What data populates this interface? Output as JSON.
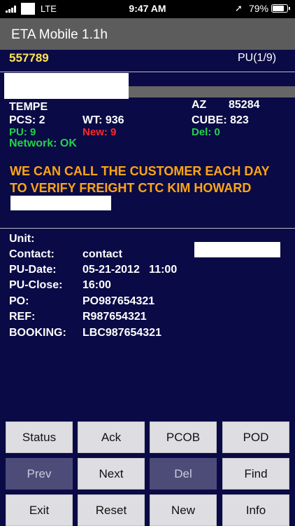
{
  "status_bar": {
    "network": "LTE",
    "time": "9:47 AM",
    "battery": "79%",
    "battery_level": 0.79
  },
  "app": {
    "title": "ETA Mobile 1.1h"
  },
  "order": {
    "number": "557789",
    "pu_counter": "PU(1/9)",
    "city": "TEMPE",
    "state": "AZ",
    "zip": "85284",
    "pcs": "PCS: 2",
    "wt": "WT: 936",
    "cube": "CUBE: 823",
    "pu": "PU: 9",
    "new": "New: 9",
    "del": "Del: 0",
    "network": "Network: OK",
    "note_line1": "WE CAN CALL THE CUSTOMER EACH DAY",
    "note_line2": "TO VERIFY FREIGHT CTC KIM HOWARD"
  },
  "details": {
    "unit_label": "Unit:",
    "contact_label": "Contact:",
    "contact_value": "contact",
    "pu_date_label": "PU-Date:",
    "pu_date_value": "05-21-2012   11:00",
    "pu_close_label": "PU-Close:",
    "pu_close_value": "16:00",
    "po_label": "PO:",
    "po_value": "PO987654321",
    "ref_label": "REF:",
    "ref_value": "R987654321",
    "booking_label": "BOOKING:",
    "booking_value": "LBC987654321"
  },
  "buttons": {
    "status": "Status",
    "ack": "Ack",
    "pcob": "PCOB",
    "pod": "POD",
    "prev": "Prev",
    "next": "Next",
    "del": "Del",
    "find": "Find",
    "exit": "Exit",
    "reset": "Reset",
    "new": "New",
    "info": "Info"
  }
}
